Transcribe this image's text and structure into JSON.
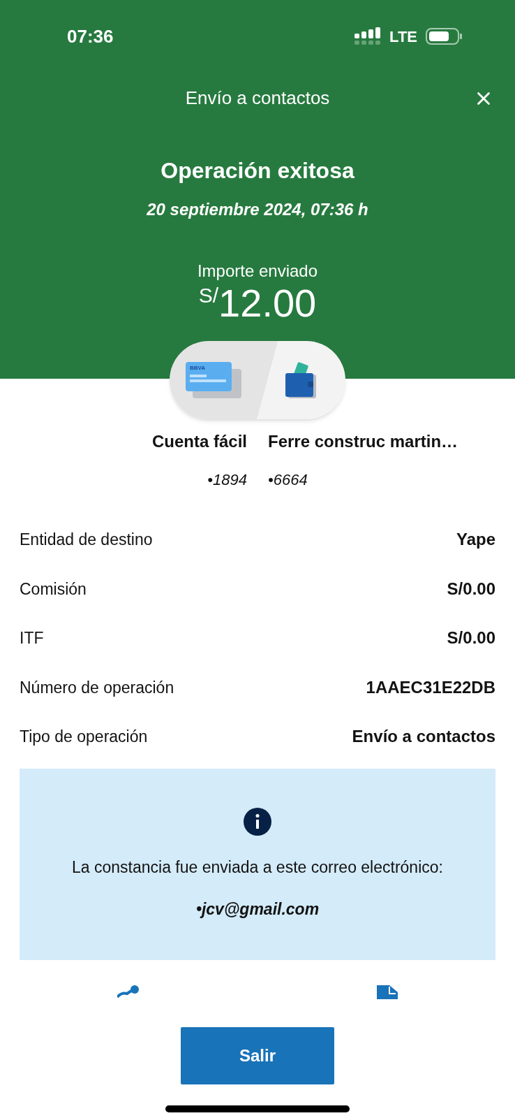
{
  "status_bar": {
    "time": "07:36",
    "network": "LTE"
  },
  "header": {
    "title": "Envío a contactos",
    "result": "Operación exitosa",
    "datetime": "20 septiembre 2024, 07:36 h",
    "amount_label": "Importe enviado",
    "currency": "S/",
    "amount": "12.00"
  },
  "transfer": {
    "card_logo": "BBVA",
    "from": {
      "name": "Cuenta fácil",
      "number": "•1894"
    },
    "to": {
      "name": "Ferre construc martin…",
      "number": "•6664"
    }
  },
  "details": [
    {
      "label": "Entidad de destino",
      "value": "Yape"
    },
    {
      "label": "Comisión",
      "value": "S/0.00"
    },
    {
      "label": "ITF",
      "value": "S/0.00"
    },
    {
      "label": "Número de operación",
      "value": "1AAEC31E22DB"
    },
    {
      "label": "Tipo de operación",
      "value": "Envío a contactos"
    }
  ],
  "notice": {
    "text": "La constancia fue enviada a este correo electrónico:",
    "email": "•jcv@gmail.com"
  },
  "exit_button": "Salir"
}
